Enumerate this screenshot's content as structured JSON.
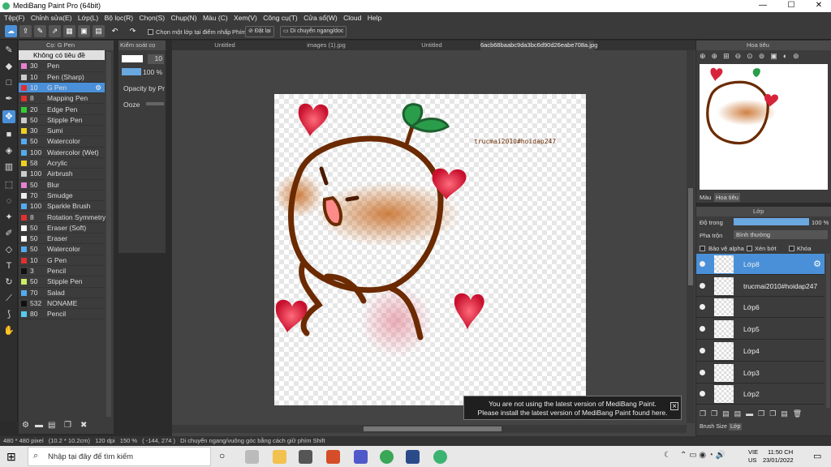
{
  "window": {
    "title": "MediBang Paint Pro (64bit)",
    "min": "—",
    "max": "☐",
    "close": "✕"
  },
  "menu": [
    "Tệp(F)",
    "Chỉnh sửa(E)",
    "Lớp(L)",
    "Bộ lọc(R)",
    "Chọn(S)",
    "Chụp(N)",
    "Màu (C)",
    "Xem(V)",
    "Công cụ(T)",
    "Cửa sổ(W)",
    "Cloud",
    "Help"
  ],
  "toolbar": {
    "select_one_layer": "Chọn một lớp tại điểm nhấp",
    "key_label": "Phím",
    "reset": "Đặt lại",
    "move": "Di chuyển ngang/doc"
  },
  "brush_panel": {
    "title": "Cọ: G Pen",
    "header": "Không có tiêu đề",
    "items": [
      {
        "size": "30",
        "name": "Pen",
        "color": "#e87fd0"
      },
      {
        "size": "10",
        "name": "Pen (Sharp)",
        "color": "#cccccc"
      },
      {
        "size": "10",
        "name": "G Pen",
        "color": "#e03030"
      },
      {
        "size": "8",
        "name": "Mapping Pen",
        "color": "#e03030"
      },
      {
        "size": "20",
        "name": "Edge Pen",
        "color": "#33cc33"
      },
      {
        "size": "50",
        "name": "Stipple Pen",
        "color": "#cccccc"
      },
      {
        "size": "30",
        "name": "Sumi",
        "color": "#f0d020"
      },
      {
        "size": "50",
        "name": "Watercolor",
        "color": "#55aaee"
      },
      {
        "size": "100",
        "name": "Watercolor (Wet)",
        "color": "#55aaee"
      },
      {
        "size": "58",
        "name": "Acrylic",
        "color": "#f0d020"
      },
      {
        "size": "100",
        "name": "Airbrush",
        "color": "#cccccc"
      },
      {
        "size": "50",
        "name": "Blur",
        "color": "#e87fd0"
      },
      {
        "size": "70",
        "name": "Smudge",
        "color": "#eeeeee"
      },
      {
        "size": "100",
        "name": "Sparkle Brush",
        "color": "#55aaee"
      },
      {
        "size": "8",
        "name": "Rotation Symmetry",
        "color": "#e03030"
      },
      {
        "size": "50",
        "name": "Eraser (Soft)",
        "color": "#ffffff"
      },
      {
        "size": "50",
        "name": "Eraser",
        "color": "#ffffff"
      },
      {
        "size": "50",
        "name": "Watercolor",
        "color": "#55aaee"
      },
      {
        "size": "10",
        "name": "G Pen",
        "color": "#e03030"
      },
      {
        "size": "3",
        "name": "Pencil",
        "color": "#111111"
      },
      {
        "size": "50",
        "name": "Stipple Pen",
        "color": "#ccee66"
      },
      {
        "size": "70",
        "name": "Salad",
        "color": "#55aaee"
      },
      {
        "size": "532",
        "name": "NONAME",
        "color": "#111111"
      },
      {
        "size": "80",
        "name": "Pencil",
        "color": "#55ccee"
      }
    ]
  },
  "control": {
    "title": "Kiểm soát cọ",
    "size": "10",
    "opacity": "100 %",
    "opacity_by": "Opacity by Pr",
    "ooze": "Ooze"
  },
  "tabs": [
    "Untitled",
    "images (1).jpg",
    "Untitled",
    "6acb68baabc9da3bc6d90d26eabe708a.jpg"
  ],
  "canvas_text": "trucmai2010#hoidap247",
  "notice": {
    "line1": "You are not using the latest version of MediBang Paint.",
    "line2": "Please install the latest version of MediBang Paint found here."
  },
  "status": {
    "size": "480 * 480 pixel",
    "cm": "(10.2 * 10.2cm)",
    "dpi": "120 dpi",
    "zoom": "150 %",
    "coord": "( -144, 274 )",
    "hint": "Di chuyển ngang/vuông góc bằng cách giữ phím Shift"
  },
  "navigator": {
    "title": "Hoa tiêu",
    "tab_color": "Màu",
    "tab_nav": "Hoa tiêu"
  },
  "layer_panel": {
    "title": "Lớp",
    "opacity_label": "Độ trong",
    "opacity_value": "100 %",
    "blend_label": "Pha trộn",
    "blend_value": "Bình thường",
    "protect_alpha": "Bảo vệ alpha",
    "clip": "Xén bớt",
    "lock": "Khóa",
    "layers": [
      "Lớp8",
      "trucmai2010#hoidap247",
      "Lớp6",
      "Lớp5",
      "Lớp4",
      "Lớp3",
      "Lớp2"
    ],
    "tab_brush_size": "Brush Size",
    "tab_layer": "Lớp"
  },
  "taskbar": {
    "search_placeholder": "Nhập tại đây để tìm kiếm",
    "lang1": "VIE",
    "lang2": "US",
    "time": "11:50 CH",
    "date": "23/01/2022"
  }
}
